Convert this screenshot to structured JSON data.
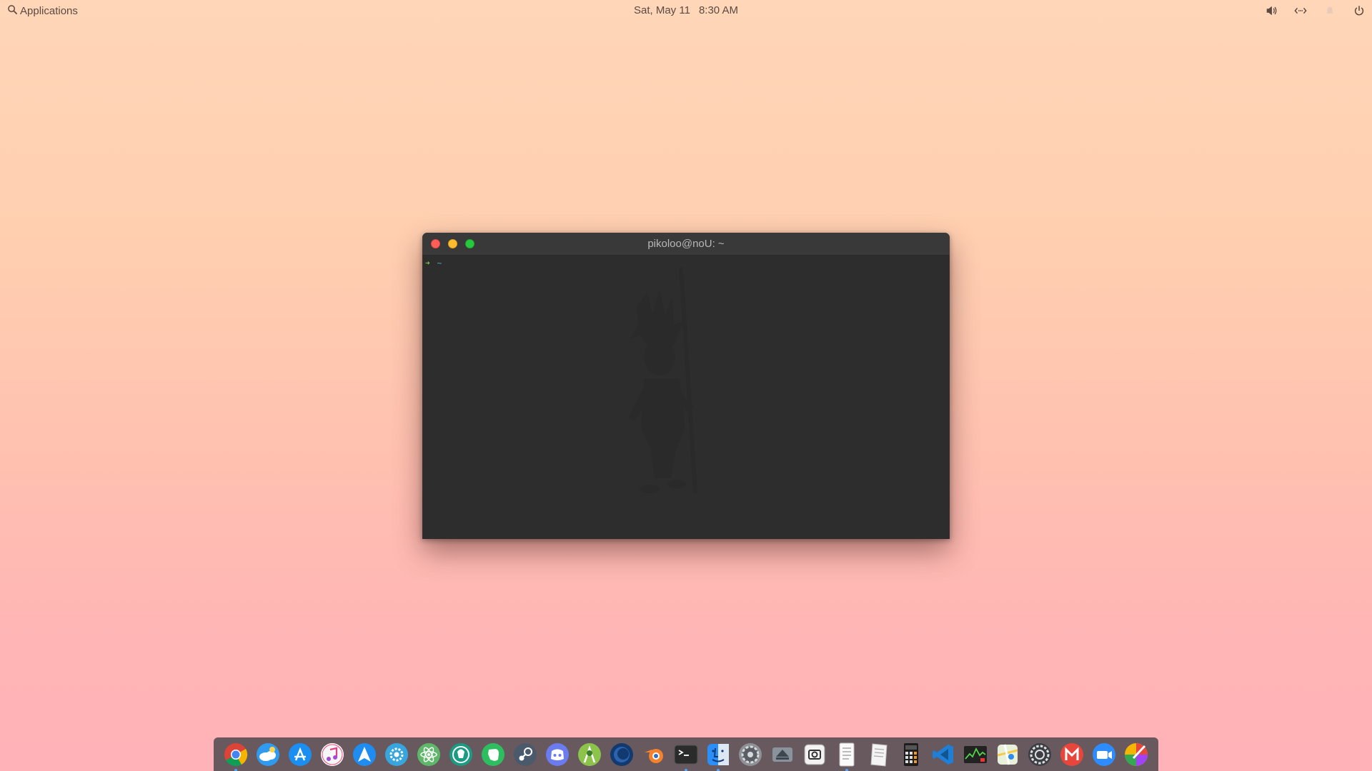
{
  "topbar": {
    "applications_label": "Applications",
    "date": "Sat, May 11",
    "time": "8:30 AM",
    "tray": [
      "volume-icon",
      "network-icon",
      "notifications-icon",
      "power-icon"
    ]
  },
  "terminal": {
    "title": "pikoloo@noU: ~",
    "prompt_arrow": "➜",
    "prompt_dir": "~"
  },
  "dock": {
    "apps": [
      {
        "name": "chrome-icon",
        "running": true
      },
      {
        "name": "cloud-weather-icon",
        "running": false
      },
      {
        "name": "app-store-icon",
        "running": false
      },
      {
        "name": "music-icon",
        "running": false
      },
      {
        "name": "send-arrow-icon",
        "running": false
      },
      {
        "name": "gear-blue-icon",
        "running": false
      },
      {
        "name": "atom-icon",
        "running": false
      },
      {
        "name": "gitkraken-icon",
        "running": false
      },
      {
        "name": "evernote-icon",
        "running": false
      },
      {
        "name": "steam-icon",
        "running": false
      },
      {
        "name": "discord-icon",
        "running": false
      },
      {
        "name": "android-studio-icon",
        "running": false
      },
      {
        "name": "eclipse-icon",
        "running": false
      },
      {
        "name": "blender-icon",
        "running": false
      },
      {
        "name": "terminal-icon",
        "running": true
      },
      {
        "name": "finder-icon",
        "running": true
      },
      {
        "name": "system-settings-icon",
        "running": false
      },
      {
        "name": "drive-icon",
        "running": false
      },
      {
        "name": "screenshot-icon",
        "running": false
      },
      {
        "name": "notes-icon",
        "running": true
      },
      {
        "name": "text-editor-icon",
        "running": false
      },
      {
        "name": "calculator-icon",
        "running": false
      },
      {
        "name": "vscode-icon",
        "running": false
      },
      {
        "name": "system-monitor-icon",
        "running": false
      },
      {
        "name": "maps-icon",
        "running": false
      },
      {
        "name": "preferences-icon",
        "running": false
      },
      {
        "name": "gmail-icon",
        "running": false
      },
      {
        "name": "zoom-icon",
        "running": false
      },
      {
        "name": "color-picker-icon",
        "running": false
      }
    ]
  },
  "colors": {
    "accent_blue": "#4ea3ff",
    "terminal_bg": "#2d2d2d",
    "close": "#ff5f57",
    "minimize": "#febc2e",
    "maximize": "#28c840"
  }
}
